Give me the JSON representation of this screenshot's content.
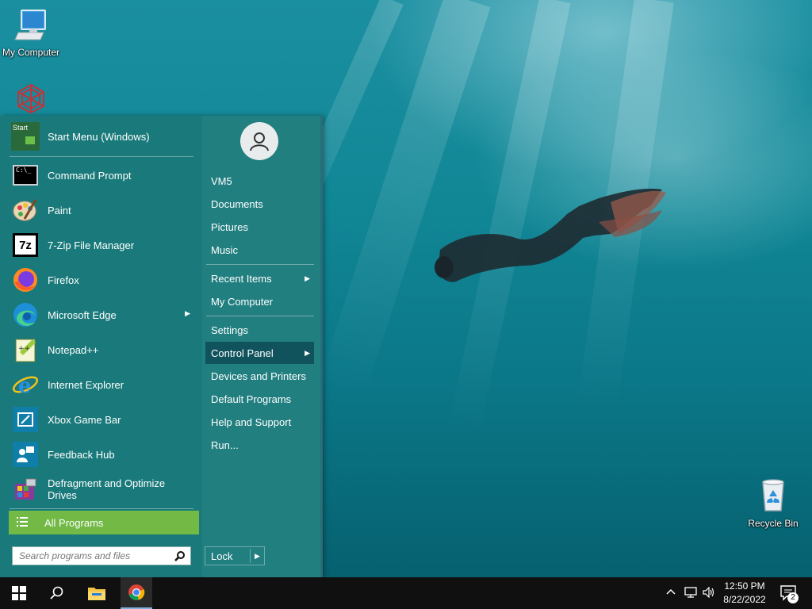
{
  "desktop": {
    "icons": [
      {
        "label": "My Computer",
        "icon": "my-computer-icon"
      },
      {
        "label": "",
        "icon": "app-shortcut-icon"
      },
      {
        "label": "Recycle Bin",
        "icon": "recycle-bin-icon"
      }
    ]
  },
  "start_menu": {
    "programs": [
      {
        "label": "Start Menu (Windows)",
        "icon": "start-menu-icon",
        "icon_text": "Start"
      },
      {
        "label": "Command Prompt",
        "icon": "command-prompt-icon",
        "icon_text": "C:\\_"
      },
      {
        "label": "Paint",
        "icon": "paint-icon"
      },
      {
        "label": "7-Zip File Manager",
        "icon": "7zip-icon",
        "icon_text": "7z"
      },
      {
        "label": "Firefox",
        "icon": "firefox-icon"
      },
      {
        "label": "Microsoft Edge",
        "icon": "edge-icon"
      },
      {
        "label": "Notepad++",
        "icon": "notepadpp-icon"
      },
      {
        "label": "Internet Explorer",
        "icon": "internet-explorer-icon"
      },
      {
        "label": "Xbox Game Bar",
        "icon": "xbox-game-bar-icon"
      },
      {
        "label": "Feedback Hub",
        "icon": "feedback-hub-icon"
      },
      {
        "label": "Defragment and Optimize Drives",
        "icon": "defrag-icon"
      }
    ],
    "all_programs_label": "All Programs",
    "search_placeholder": "Search programs and files",
    "user_avatar": "user-avatar-icon",
    "places": [
      {
        "label": "VM5"
      },
      {
        "label": "Documents"
      },
      {
        "label": "Pictures"
      },
      {
        "label": "Music"
      },
      {
        "label": "Recent Items"
      },
      {
        "label": "My Computer"
      },
      {
        "label": "Settings"
      },
      {
        "label": "Control Panel"
      },
      {
        "label": "Devices and Printers"
      },
      {
        "label": "Default Programs"
      },
      {
        "label": "Help and Support"
      },
      {
        "label": "Run..."
      }
    ],
    "highlighted_item": "Control Panel",
    "lock_label": "Lock"
  },
  "taskbar": {
    "buttons": [
      "windows-start-icon",
      "search-icon",
      "file-explorer-icon",
      "chrome-icon"
    ],
    "time": "12:50 PM",
    "date": "8/22/2022",
    "notification_count": "2",
    "colors": {
      "taskbar_bg": "#101010",
      "all_programs_bg": "#72b946",
      "menu_bg": "#1d7f80"
    }
  }
}
